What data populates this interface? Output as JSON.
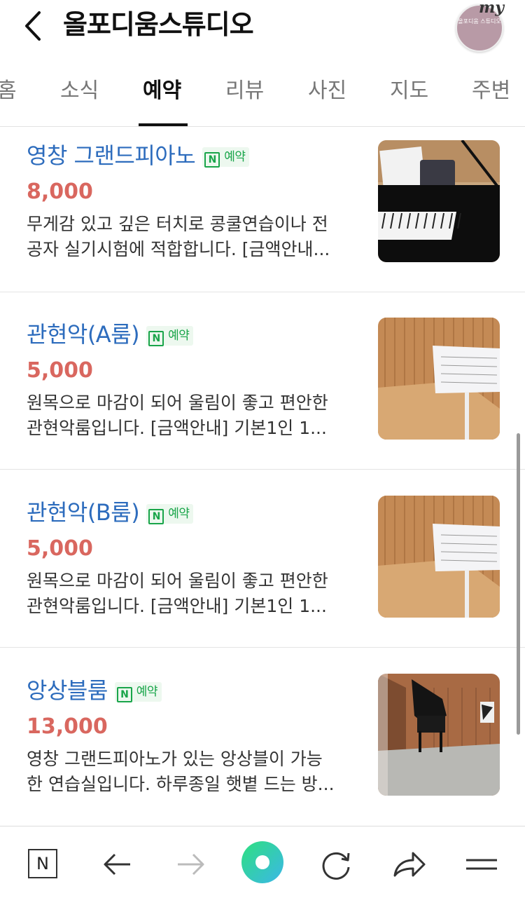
{
  "header": {
    "title": "올포디움스튜디오",
    "logo_text": "올포디움\n스튜디오",
    "my_label": "my"
  },
  "tabs": [
    {
      "label": "홈"
    },
    {
      "label": "소식"
    },
    {
      "label": "예약"
    },
    {
      "label": "리뷰"
    },
    {
      "label": "사진"
    },
    {
      "label": "지도"
    },
    {
      "label": "주변"
    }
  ],
  "active_tab": "예약",
  "items": [
    {
      "name": "영창 그랜드피아노",
      "badge": "예약",
      "badge_icon": "N",
      "price": "8,000",
      "desc_line1": "무게감 있고 깊은 터치로 콩쿨연습이나 전",
      "desc_line2": "공자 실기시험에 적합합니다. [금액안내...",
      "image": "grand-piano-photo"
    },
    {
      "name": "관현악(A룸)",
      "badge": "예약",
      "badge_icon": "N",
      "price": "5,000",
      "desc_line1": "원목으로 마감이 되어 울림이 좋고 편안한",
      "desc_line2": "관현악룸입니다. [금액안내] 기본1인 1...",
      "image": "music-stand-room-photo"
    },
    {
      "name": "관현악(B룸)",
      "badge": "예약",
      "badge_icon": "N",
      "price": "5,000",
      "desc_line1": "원목으로 마감이 되어 울림이 좋고 편안한",
      "desc_line2": "관현악룸입니다. [금액안내] 기본1인 1...",
      "image": "music-stand-room-photo"
    },
    {
      "name": "앙상블룸",
      "badge": "예약",
      "badge_icon": "N",
      "price": "13,000",
      "desc_line1": "영창 그랜드피아노가 있는 앙상블이 가능",
      "desc_line2": "한 연습실입니다. 하루종일 햇볕 드는 방...",
      "image": "ensemble-room-photo"
    }
  ],
  "bottom_bar": {
    "home_icon_label": "N",
    "icons": [
      "naver-home-icon",
      "back-arrow-icon",
      "forward-arrow-icon",
      "green-dot-icon",
      "refresh-icon",
      "share-icon",
      "menu-icon"
    ]
  },
  "colors": {
    "item_title": "#2d6cbd",
    "price": "#d9675f",
    "badge_green": "#19a54a"
  }
}
